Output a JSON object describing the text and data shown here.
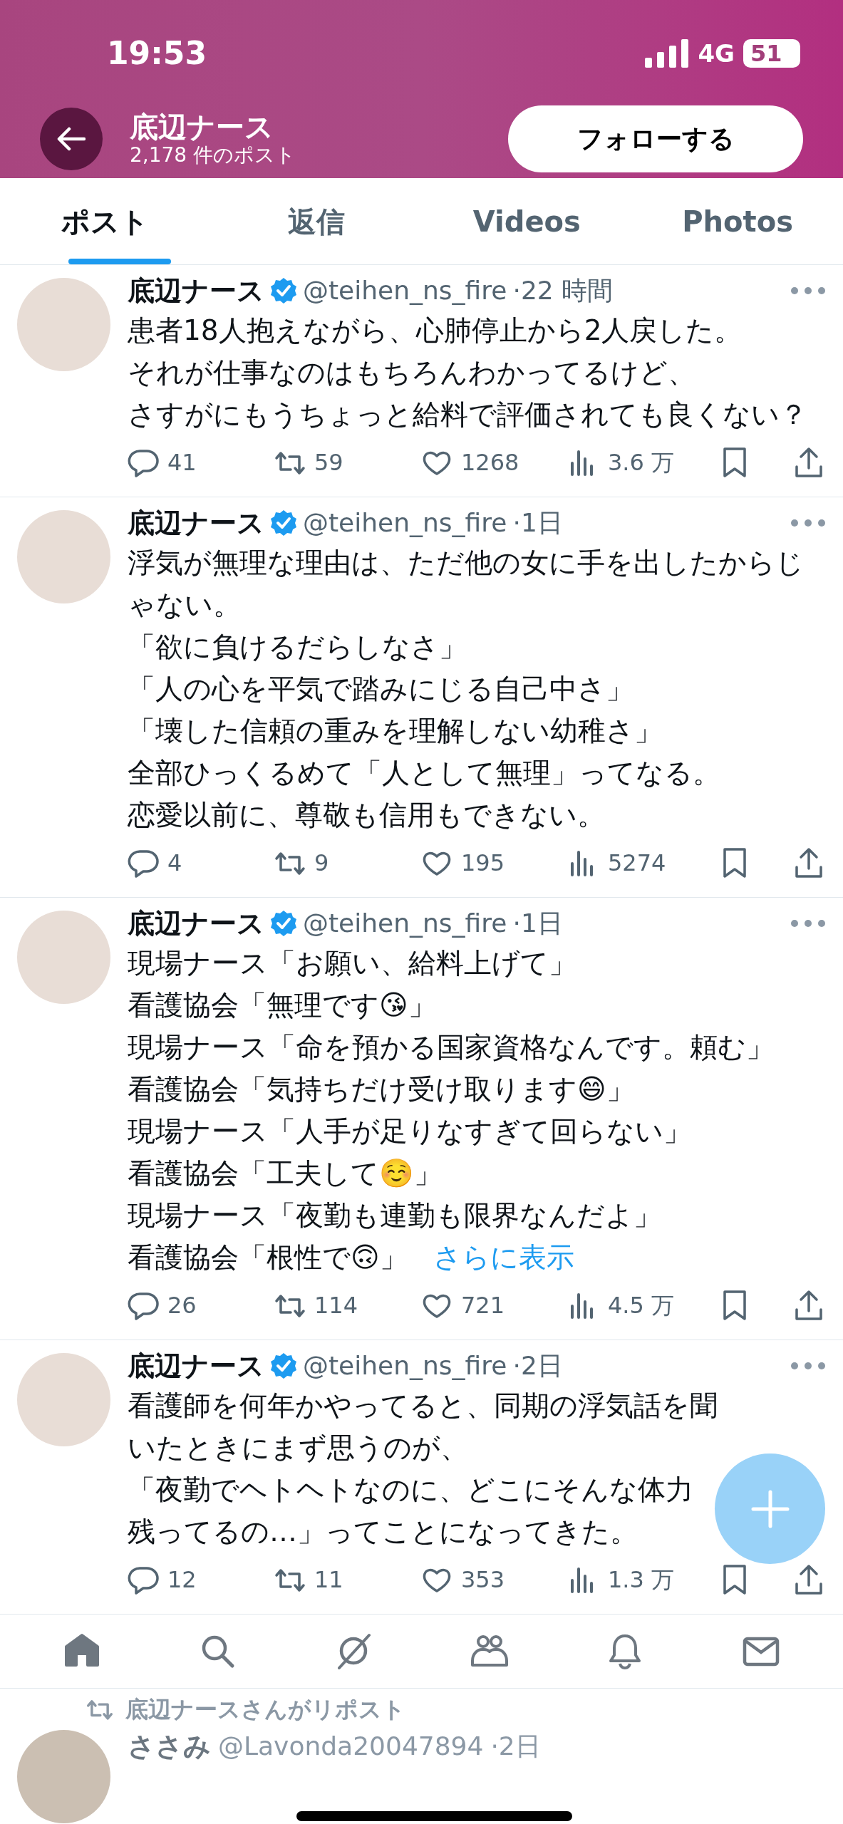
{
  "status_bar": {
    "time": "19:53",
    "network": "4G",
    "battery": "51"
  },
  "header": {
    "name": "底辺ナース",
    "post_count": "2,178 件のポスト",
    "follow_button": "フォローする"
  },
  "tabs": [
    {
      "label": "ポスト",
      "selected": true
    },
    {
      "label": "返信",
      "selected": false
    },
    {
      "label": "Videos",
      "selected": false
    },
    {
      "label": "Photos",
      "selected": false
    }
  ],
  "tweets": [
    {
      "name": "底辺ナース",
      "verified": true,
      "handle": "@teihen_ns_fire",
      "time": "·22 時間",
      "lines": [
        "患者18人抱えながら、心肺停止から2人戻した。",
        "それが仕事なのはもちろんわかってるけど、",
        "さすがにもうちょっと給料で評価されても良くない？"
      ],
      "replies": "41",
      "reposts": "59",
      "likes": "1268",
      "views": "3.6 万"
    },
    {
      "name": "底辺ナース",
      "verified": true,
      "handle": "@teihen_ns_fire",
      "time": "·1日",
      "lines": [
        "浮気が無理な理由は、ただ他の女に手を出したからじゃない。",
        "「欲に負けるだらしなさ」",
        "「人の心を平気で踏みにじる自己中さ」",
        "「壊した信頼の重みを理解しない幼稚さ」",
        "全部ひっくるめて「人として無理」ってなる。",
        "恋愛以前に、尊敬も信用もできない。"
      ],
      "replies": "4",
      "reposts": "9",
      "likes": "195",
      "views": "5274"
    },
    {
      "name": "底辺ナース",
      "verified": true,
      "handle": "@teihen_ns_fire",
      "time": "·1日",
      "lines": [
        "現場ナース「お願い、給料上げて」",
        "看護協会「無理です😘」",
        "現場ナース「命を預かる国家資格なんです。頼む」",
        "看護協会「気持ちだけ受け取ります😄」",
        "現場ナース「人手が足りなすぎて回らない」",
        "看護協会「工夫して☺️」",
        "現場ナース「夜勤も連勤も限界なんだよ」",
        "看護協会「根性で🙃」"
      ],
      "show_more": "さらに表示",
      "replies": "26",
      "reposts": "114",
      "likes": "721",
      "views": "4.5 万"
    },
    {
      "name": "底辺ナース",
      "verified": true,
      "handle": "@teihen_ns_fire",
      "time": "·2日",
      "lines": [
        "看護師を何年かやってると、同期の浮気話を聞いたときにまず思うのが、",
        "「夜勤でヘトヘトなのに、どこにそんな体力残ってるの…」ってことになってきた。"
      ],
      "replies": "12",
      "reposts": "11",
      "likes": "353",
      "views": "1.3 万"
    }
  ],
  "bottom_nav": [
    {
      "kind": "home",
      "selected": true
    },
    {
      "kind": "search",
      "selected": false
    },
    {
      "kind": "grok",
      "selected": false
    },
    {
      "kind": "communities",
      "selected": false
    },
    {
      "kind": "notifications",
      "selected": false
    },
    {
      "kind": "messages",
      "selected": false
    }
  ],
  "repost_notice": "底辺ナースさんがリポスト",
  "next_tweet": {
    "name": "ささみ",
    "handle": "@Lavonda20047894",
    "time": "·2日"
  }
}
